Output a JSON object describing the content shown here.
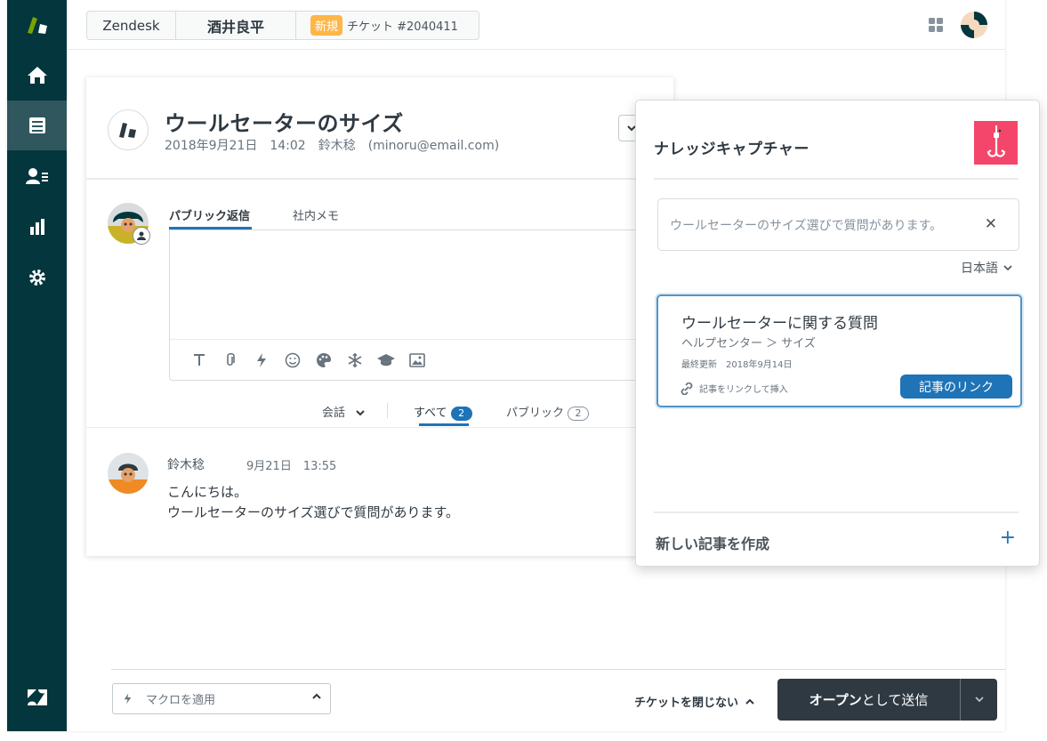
{
  "topbar": {
    "brand_tab": "Zendesk",
    "person_tab": "酒井良平",
    "ticket_badge": "新規",
    "ticket_label": "チケット #2040411"
  },
  "ticket": {
    "title": "ウールセーターのサイズ",
    "meta": "2018年9月21日　14:02　鈴木稔　(minoru@email.com)"
  },
  "composer": {
    "tab_public": "パブリック返信",
    "tab_internal": "社内メモ"
  },
  "filters": {
    "conversation": "会話",
    "all": "すべて",
    "all_count": "2",
    "public": "パブリック",
    "public_count": "2"
  },
  "comment": {
    "author": "鈴木稔",
    "time": "9月21日　13:55",
    "line1": "こんにちは。",
    "line2": "ウールセーターのサイズ選びで質問があります。"
  },
  "footer": {
    "macro_placeholder": "マクロを適用",
    "stay_open": "チケットを閉じない",
    "submit_bold": "オープン",
    "submit_rest": "として送信"
  },
  "knowledge": {
    "title": "ナレッジキャプチャー",
    "search_value": "ウールセーターのサイズ選びで質問があります。",
    "language": "日本語",
    "result": {
      "title": "ウールセーターに関する質問",
      "path": "ヘルプセンター ＞ サイズ",
      "updated": "最終更新　2018年9月14日",
      "insert_label": "記事をリンクして挿入",
      "link_button": "記事のリンク"
    },
    "new_article": "新しい記事を作成"
  },
  "colors": {
    "sidebar": "#03363d",
    "accent": "#1f73b7",
    "new_badge": "#ffb648",
    "kc_logo": "#f4466b",
    "submit": "#2f3941"
  },
  "icons": [
    "zendesk-logo-icon",
    "home-icon",
    "views-icon",
    "customers-icon",
    "reporting-icon",
    "admin-icon",
    "zendesk-z-icon",
    "apps-grid-icon"
  ]
}
